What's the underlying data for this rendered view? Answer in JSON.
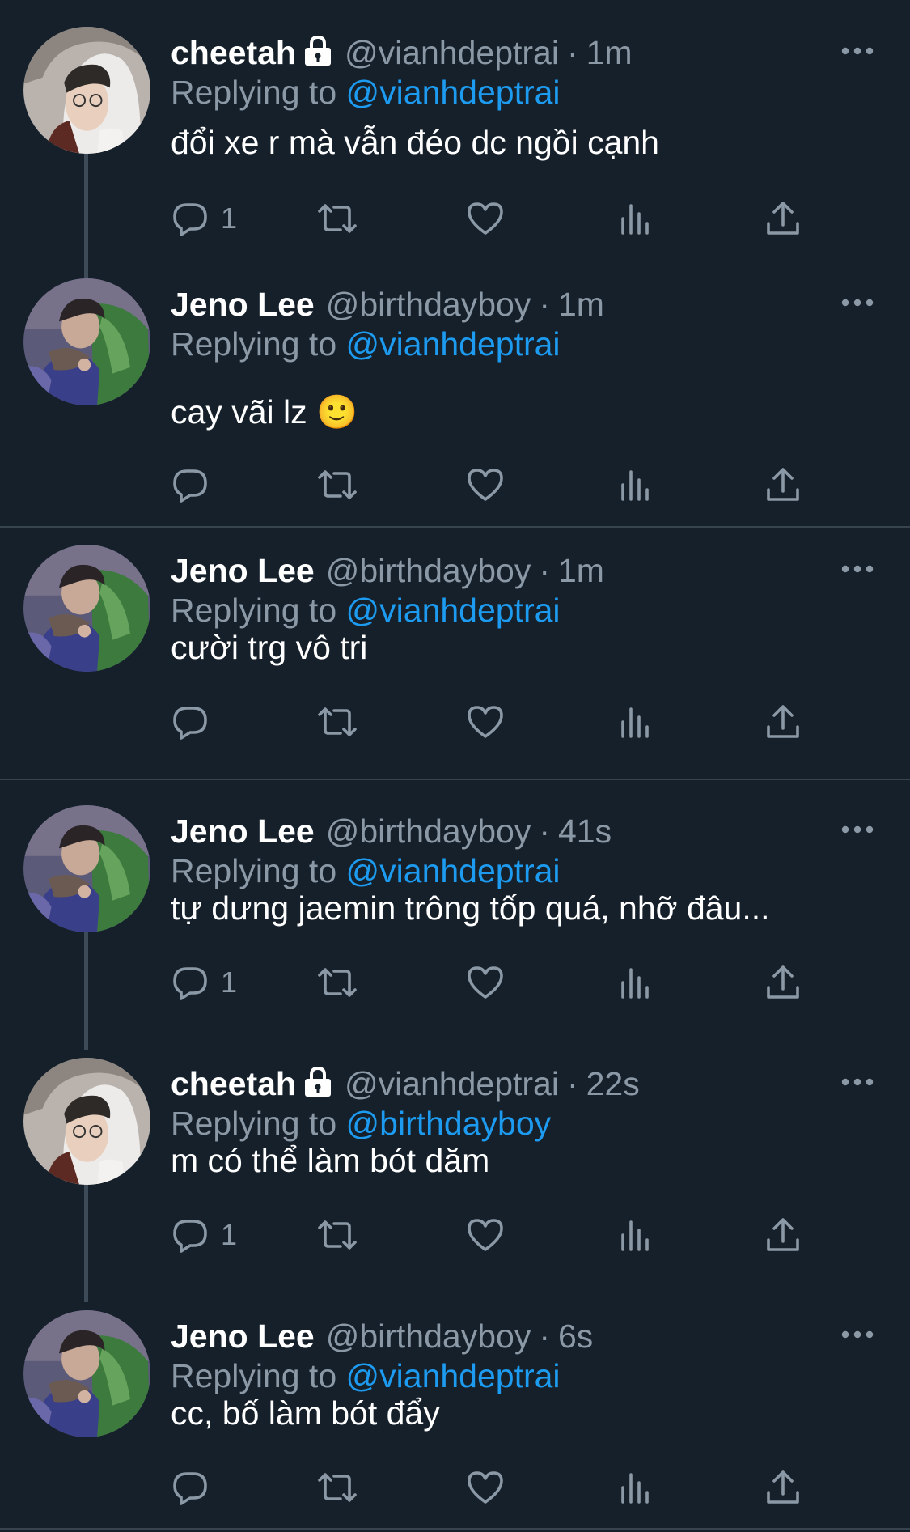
{
  "tweets": [
    {
      "name": "cheetah",
      "locked": true,
      "handle": "@vianhdeptrai",
      "time": "1m",
      "replying_label": "Replying to",
      "replying_to": "@vianhdeptrai",
      "text": "đổi xe r mà vẫn đéo dc ngồi cạnh",
      "reply_count": "1",
      "avatar": "white-hood"
    },
    {
      "name": "Jeno Lee",
      "locked": false,
      "handle": "@birthdayboy",
      "time": "1m",
      "replying_label": "Replying to",
      "replying_to": "@vianhdeptrai",
      "text": "cay vãi lz 🙂",
      "reply_count": "",
      "avatar": "green-jacket"
    },
    {
      "name": "Jeno Lee",
      "locked": false,
      "handle": "@birthdayboy",
      "time": "1m",
      "replying_label": "Replying to",
      "replying_to": "@vianhdeptrai",
      "text": "cười trg vô tri",
      "reply_count": "",
      "avatar": "green-jacket"
    },
    {
      "name": "Jeno Lee",
      "locked": false,
      "handle": "@birthdayboy",
      "time": "41s",
      "replying_label": "Replying to",
      "replying_to": "@vianhdeptrai",
      "text": "tự dưng jaemin trông tốp quá, nhỡ đâu...",
      "reply_count": "1",
      "avatar": "green-jacket"
    },
    {
      "name": "cheetah",
      "locked": true,
      "handle": "@vianhdeptrai",
      "time": "22s",
      "replying_label": "Replying to",
      "replying_to": "@birthdayboy",
      "text": "m có thể làm bót dăm",
      "reply_count": "1",
      "avatar": "white-hood"
    },
    {
      "name": "Jeno Lee",
      "locked": false,
      "handle": "@birthdayboy",
      "time": "6s",
      "replying_label": "Replying to",
      "replying_to": "@vianhdeptrai",
      "text": "cc, bố làm bót đẩy",
      "reply_count": "",
      "avatar": "green-jacket"
    }
  ],
  "separator": "·",
  "icons": {
    "more": "more-horizontal-icon",
    "reply": "reply-icon",
    "retweet": "retweet-icon",
    "like": "heart-icon",
    "views": "views-icon",
    "share": "share-icon",
    "lock": "lock-icon"
  },
  "colors": {
    "background": "#15202b",
    "text": "#ffffff",
    "muted": "#8b98a5",
    "link": "#1d9bf0",
    "divider": "#38444d",
    "thread_line": "#3d4a58"
  }
}
